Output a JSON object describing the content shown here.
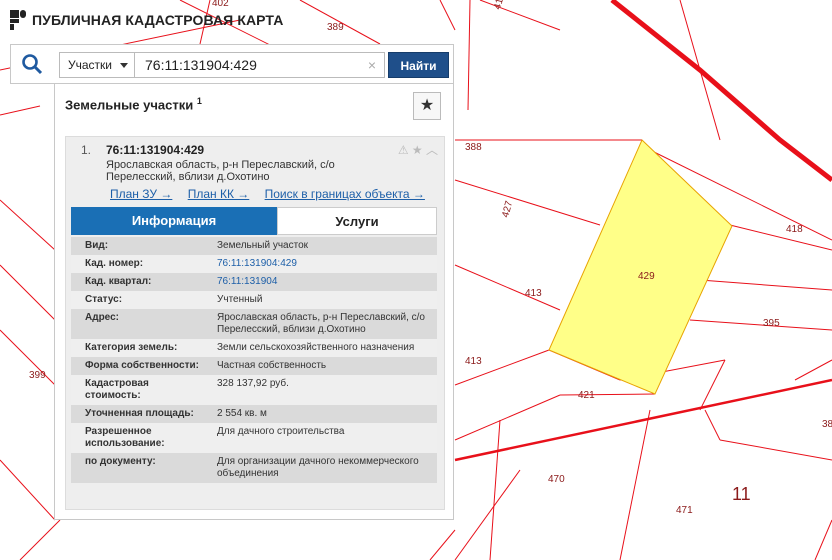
{
  "app": {
    "title": "ПУБЛИЧНАЯ КАДАСТРОВАЯ КАРТА"
  },
  "search": {
    "type_label": "Участки",
    "query": "76:11:131904:429",
    "clear_symbol": "×",
    "find_label": "Найти"
  },
  "results": {
    "title": "Земельные участки",
    "count": "1",
    "star": "★"
  },
  "item": {
    "index": "1.",
    "cad_number": "76:11:131904:429",
    "address": "Ярославская область, р-н Переславский, с/о Перелесский, вблизи д.Охотино",
    "icons": "⚠ ★ ︿",
    "links": [
      "План ЗУ →",
      "План КК →",
      "Поиск в границах объекта →"
    ],
    "tabs": [
      "Информация",
      "Услуги"
    ],
    "attributes": [
      {
        "key": "Вид:",
        "value": "Земельный участок"
      },
      {
        "key": "Кад. номер:",
        "value": "76:11:131904:429"
      },
      {
        "key": "Кад. квартал:",
        "value": "76:11:131904"
      },
      {
        "key": "Статус:",
        "value": "Учтенный"
      },
      {
        "key": "Адрес:",
        "value": "Ярославская область, р-н Переславский, с/о Перелесский, вблизи д.Охотино"
      },
      {
        "key": "Категория земель:",
        "value": "Земли сельскохозяйственного назначения"
      },
      {
        "key": "Форма собственности:",
        "value": "Частная собственность"
      },
      {
        "key": "Кадастровая стоимость:",
        "value": "328 137,92 руб."
      },
      {
        "key": "Уточненная площадь:",
        "value": "2 554 кв. м"
      },
      {
        "key": "Разрешенное использование:",
        "value": "Для дачного строительства"
      },
      {
        "key": "по документу:",
        "value": "Для организации дачного некоммерческого объединения"
      }
    ]
  },
  "map": {
    "labels": [
      "389",
      "402",
      "388",
      "427",
      "413",
      "413",
      "399",
      "421",
      "470",
      "471",
      "418",
      "395",
      "429",
      "11",
      "38",
      "41"
    ],
    "highlight_color": "#ffff88",
    "border_color": "#e8101a"
  }
}
